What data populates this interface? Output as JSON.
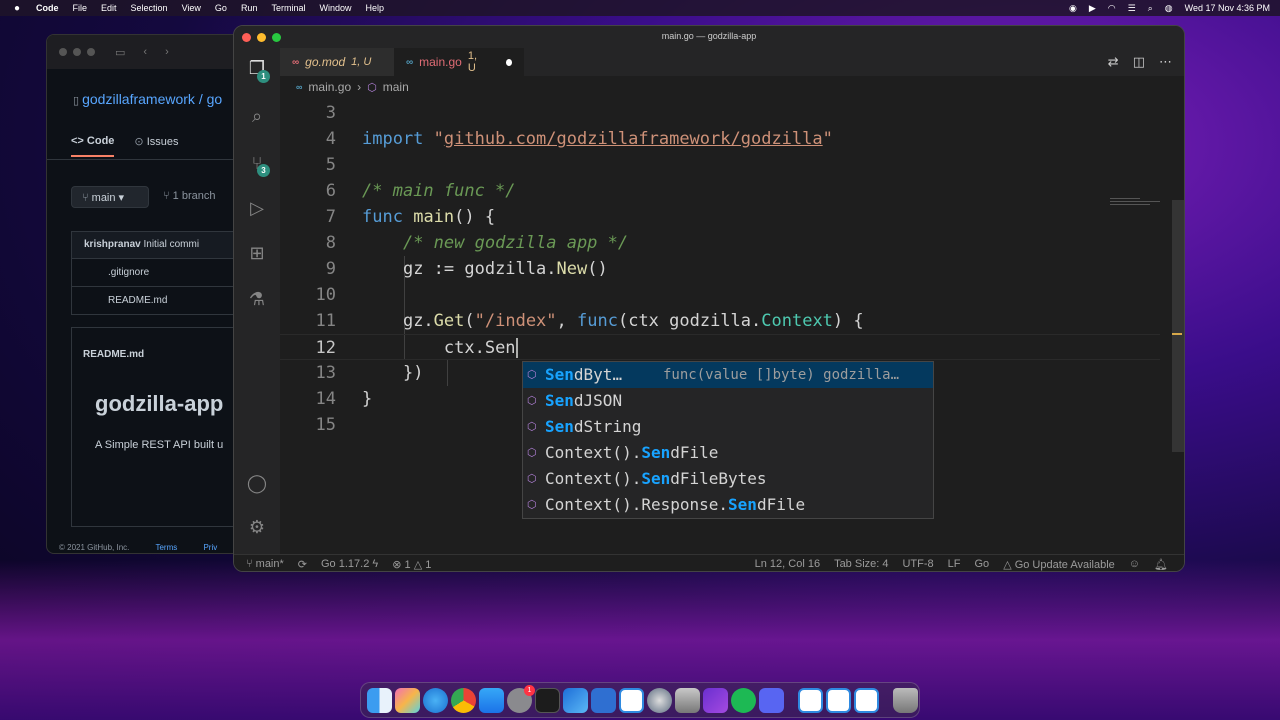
{
  "menubar": {
    "app": "Code",
    "items": [
      "File",
      "Edit",
      "Selection",
      "View",
      "Go",
      "Run",
      "Terminal",
      "Window",
      "Help"
    ],
    "clock": "Wed 17 Nov  4:36 PM"
  },
  "browser": {
    "repo": "godzillaframework / go",
    "tab_code": "Code",
    "tab_issues": "Issues",
    "branch": "main",
    "branches": "1 branch",
    "commit_author": "krishpranav",
    "commit_msg": "Initial commi",
    "files": [
      ".gitignore",
      "README.md"
    ],
    "readme_label": "README.md",
    "readme_title": "godzilla-app",
    "readme_text": "A Simple REST API built u",
    "footer_copy": "© 2021 GitHub, Inc.",
    "footer_terms": "Terms",
    "footer_privacy": "Priv"
  },
  "vscode": {
    "title": "main.go — godzilla-app",
    "tabs": [
      {
        "name": "go.mod",
        "status": "1, U"
      },
      {
        "name": "main.go",
        "status": "1, U"
      }
    ],
    "breadcrumb": {
      "file": "main.go",
      "symbol": "main"
    },
    "badges": {
      "explorer": "1",
      "scm": "3"
    },
    "code": {
      "l3": "3",
      "l4n": "4",
      "l4_kw": "import",
      "l4_q1": "\"",
      "l4_url": "github.com/godzillaframework/godzilla",
      "l4_q2": "\"",
      "l5": "5",
      "l6n": "6",
      "l6_cmt": "/* main func */",
      "l7n": "7",
      "l7_kw": "func",
      "l7_fn": "main",
      "l7_rest": "() {",
      "l8n": "8",
      "l8_cmt": "/* new godzilla app */",
      "l9n": "9",
      "l9_a": "gz := godzilla.",
      "l9_fn": "New",
      "l9_b": "()",
      "l10": "10",
      "l11n": "11",
      "l11_a": "gz.",
      "l11_get": "Get",
      "l11_p": "(",
      "l11_str": "\"/index\"",
      "l11_c": ", ",
      "l11_kw": "func",
      "l11_b": "(ctx godzilla.",
      "l11_typ": "Context",
      "l11_d": ") {",
      "l12n": "12",
      "l12_a": "ctx.Sen",
      "l13n": "13",
      "l13_a": "})",
      "l14n": "14",
      "l14_a": "}",
      "l15": "15"
    },
    "suggestions": [
      {
        "pre": "",
        "hl": "Sen",
        "post": "dByt…",
        "detail": "func(value []byte) godzilla…"
      },
      {
        "pre": "",
        "hl": "Sen",
        "post": "dJSON",
        "detail": ""
      },
      {
        "pre": "",
        "hl": "Sen",
        "post": "dString",
        "detail": ""
      },
      {
        "pre": "Context().",
        "hl": "Sen",
        "post": "dFile",
        "detail": ""
      },
      {
        "pre": "Context().",
        "hl": "Sen",
        "post": "dFileBytes",
        "detail": ""
      },
      {
        "pre": "Context().Response.",
        "hl": "Sen",
        "post": "dFile",
        "detail": ""
      }
    ],
    "status": {
      "branch": "main*",
      "go_version": "Go 1.17.2",
      "errors": "1",
      "warnings": "1",
      "position": "Ln 12, Col 16",
      "tab_size": "Tab Size: 4",
      "encoding": "UTF-8",
      "eol": "LF",
      "language": "Go",
      "update": "Go Update Available"
    }
  },
  "dock": {
    "icons": [
      "finder-icon",
      "launchpad-icon",
      "safari-icon",
      "chrome-icon",
      "app-store-icon",
      "system-preferences-icon",
      "terminal-icon",
      "xcode-icon",
      "simulator-icon",
      "vscode-icon",
      "proxyman-icon",
      "disk-utility-icon",
      "imovie-icon",
      "spotify-icon",
      "discord-icon",
      "vscode-icon-2",
      "vscode-icon-3",
      "vscode-icon-4",
      "trash-icon"
    ],
    "notification_count": "1"
  }
}
